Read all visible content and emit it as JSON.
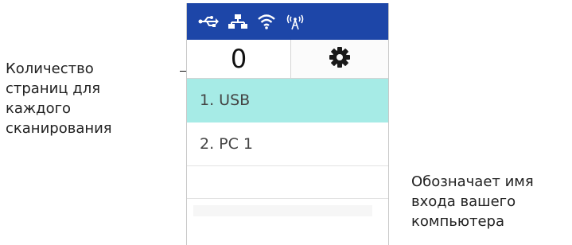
{
  "callouts": {
    "left": "Количество\nстраниц для\nкаждого\nсканирования",
    "right": "Обозначает имя\nвхода вашего\nкомпьютера"
  },
  "status_bar": {
    "background": "#1d46a8",
    "icons": [
      "usb-icon",
      "network-icon",
      "wifi-icon",
      "wireless-signal-icon"
    ]
  },
  "counter": {
    "value": "0"
  },
  "settings": {
    "icon": "gear-icon"
  },
  "list": {
    "items": [
      {
        "label": "1. USB",
        "selected": true
      },
      {
        "label": "2. PC 1",
        "selected": false
      }
    ],
    "selected_color": "#a6ebe6"
  }
}
